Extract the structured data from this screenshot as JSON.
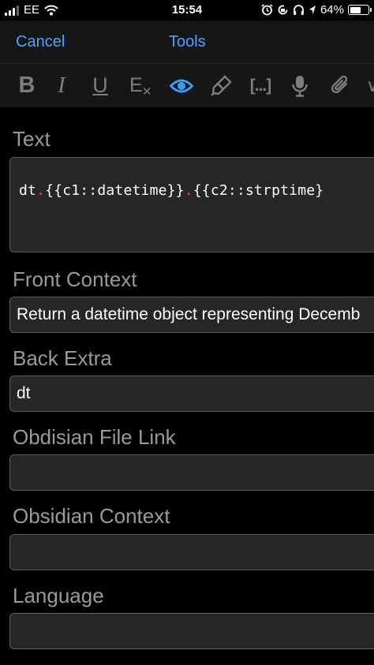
{
  "status_bar": {
    "carrier": "EE",
    "time": "15:54",
    "battery_percent": "64%",
    "battery_level": 0.64
  },
  "nav": {
    "cancel_label": "Cancel",
    "title": "Tools"
  },
  "toolbar": {
    "items": [
      {
        "icon": "bold-icon",
        "glyph": "B"
      },
      {
        "icon": "italic-icon",
        "glyph": "I"
      },
      {
        "icon": "underline-icon",
        "glyph": "U"
      },
      {
        "icon": "clear-format-icon",
        "glyph": "E"
      },
      {
        "icon": "preview-eye-icon",
        "active": true
      },
      {
        "icon": "highlighter-icon"
      },
      {
        "icon": "cloze-icon",
        "glyph": "[...]"
      },
      {
        "icon": "microphone-icon"
      },
      {
        "icon": "attachment-icon"
      }
    ],
    "accent_color": "#3b9cf2"
  },
  "fields": {
    "text": {
      "label": "Text",
      "segments": [
        "dt",
        ".",
        "{{c1::datetime}}",
        ".",
        "{{c2::strptime}"
      ]
    },
    "front_context": {
      "label": "Front Context",
      "value": "Return a datetime object representing Decemb"
    },
    "back_extra": {
      "label": "Back Extra",
      "value": "dt"
    },
    "obsidian_file_link": {
      "label": "Obdisian File Link",
      "value": ""
    },
    "obsidian_context": {
      "label": "Obsidian Context",
      "value": ""
    },
    "language": {
      "label": "Language",
      "value": ""
    }
  }
}
